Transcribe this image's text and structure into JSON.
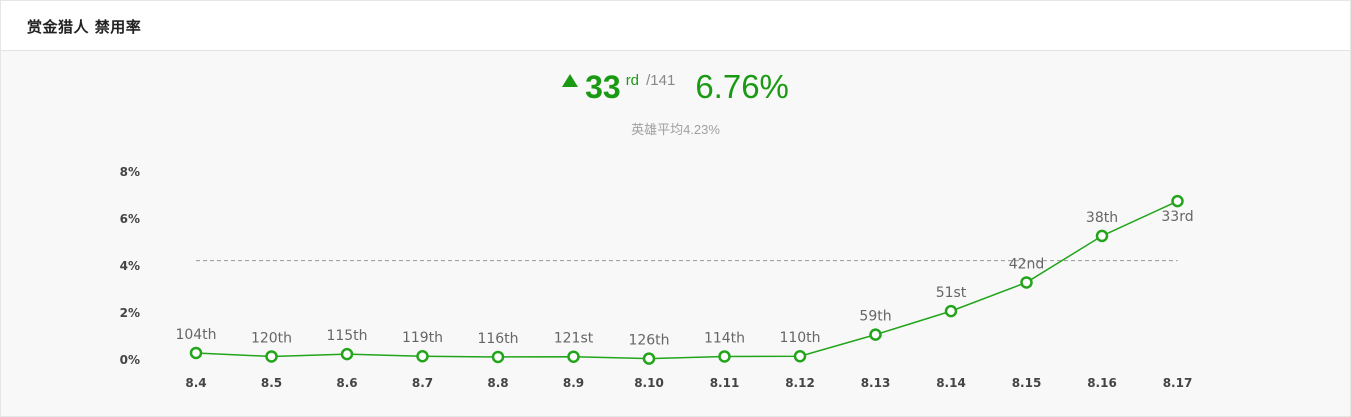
{
  "header": {
    "title": "赏金猎人 禁用率"
  },
  "summary": {
    "rank": "33",
    "rank_suffix": "rd",
    "rank_total": "/141",
    "rate": "6.76%",
    "average_text": "英雄平均4.23%"
  },
  "colors": {
    "accent": "#1a9a13",
    "line": "#22a51a",
    "average_line": "#999999"
  },
  "chart_data": {
    "type": "line",
    "title": "",
    "xlabel": "",
    "ylabel": "",
    "categories": [
      "8.4",
      "8.5",
      "8.6",
      "8.7",
      "8.8",
      "8.9",
      "8.10",
      "8.11",
      "8.12",
      "8.13",
      "8.14",
      "8.15",
      "8.16",
      "8.17"
    ],
    "series": [
      {
        "values": [
          0.3,
          0.15,
          0.25,
          0.16,
          0.13,
          0.14,
          0.06,
          0.15,
          0.16,
          1.08,
          2.08,
          3.3,
          5.28,
          6.76
        ],
        "point_labels": [
          "104th",
          "120th",
          "115th",
          "119th",
          "116th",
          "121st",
          "126th",
          "114th",
          "110th",
          "59th",
          "51st",
          "42nd",
          "38th",
          "33rd"
        ]
      }
    ],
    "reference_line": {
      "value": 4.23
    },
    "yticks": [
      "0%",
      "2%",
      "4%",
      "6%",
      "8%"
    ],
    "ylim": [
      0,
      8
    ],
    "grid": false,
    "legend": "none"
  }
}
